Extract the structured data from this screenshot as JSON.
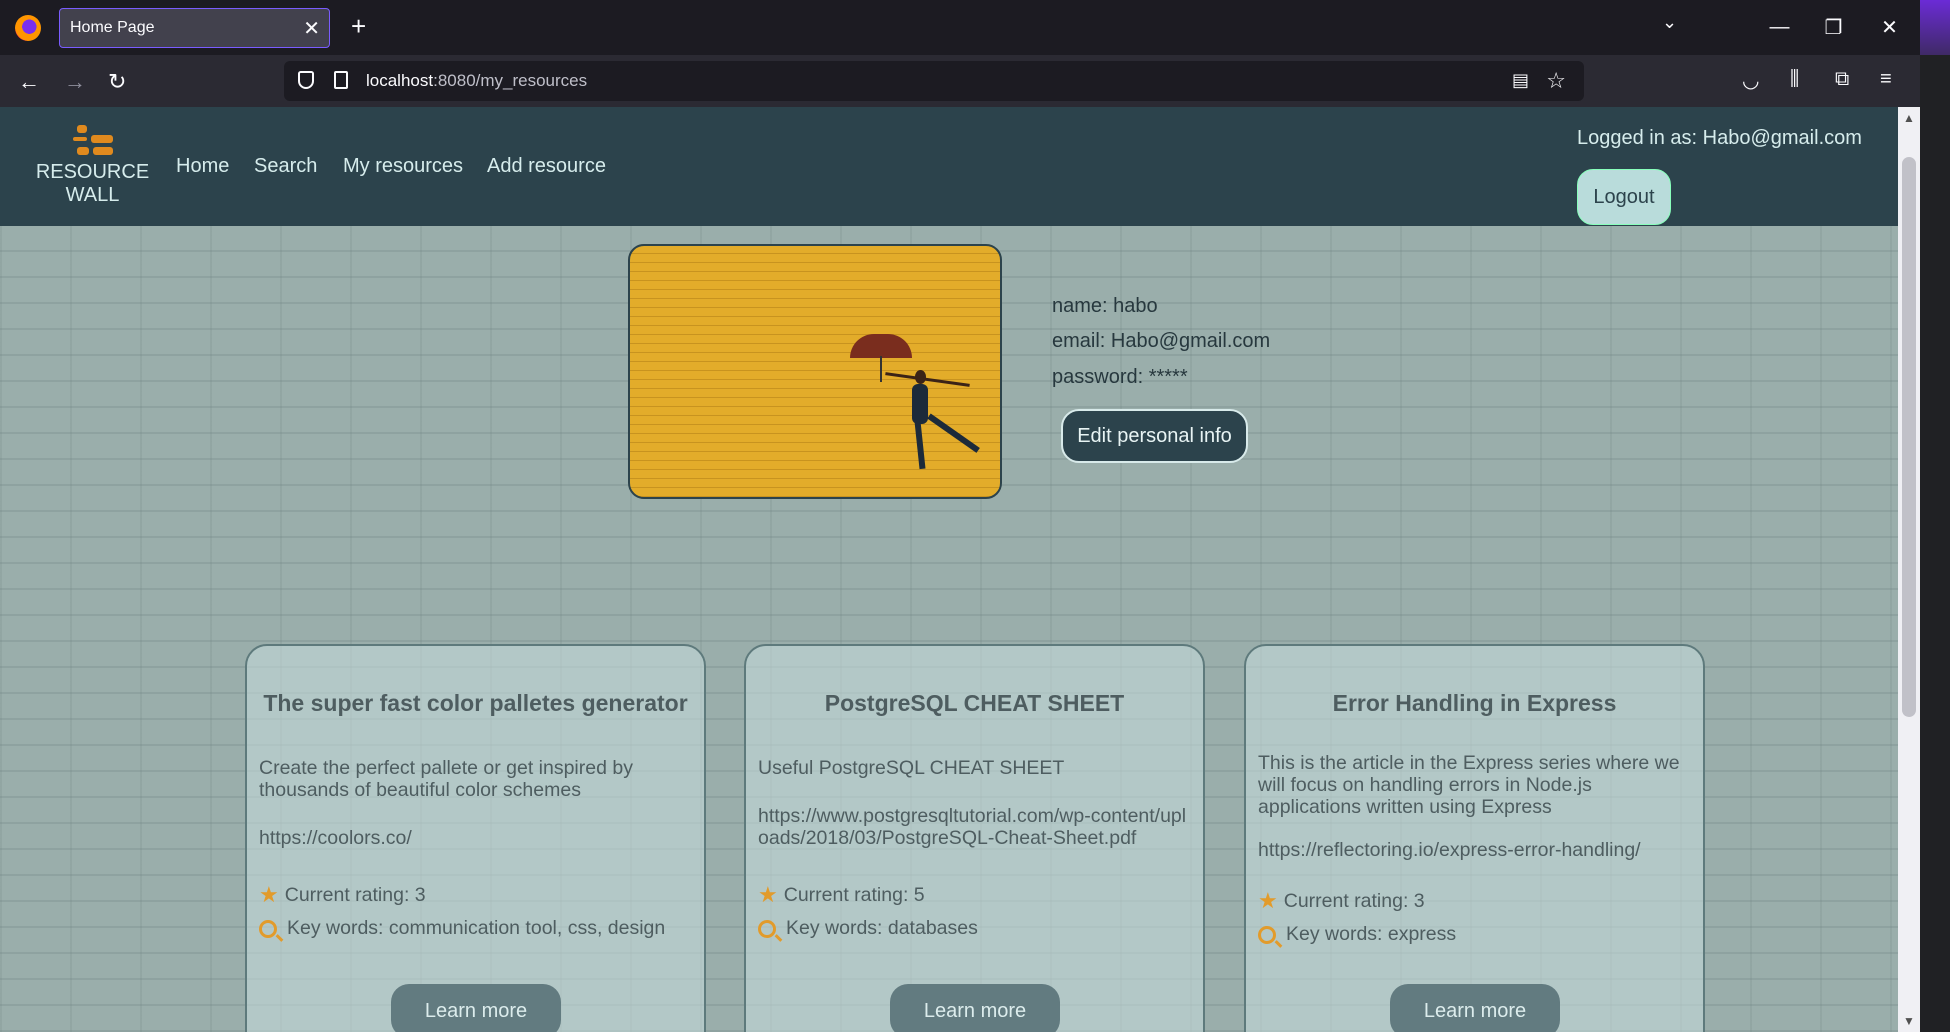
{
  "browser": {
    "tab_title": "Home Page",
    "url_host": "localhost",
    "url_path": ":8080/my_resources"
  },
  "header": {
    "logo_text_line1": "RESOURCE",
    "logo_text_line2": "WALL",
    "nav": [
      "Home",
      "Search",
      "My resources",
      "Add resource"
    ],
    "logged_in": "Logged in as: Habo@gmail.com",
    "logout_label": "Logout"
  },
  "profile": {
    "name": "name: habo",
    "email": "email: Habo@gmail.com",
    "password": "password: *****",
    "edit_label": "Edit personal info"
  },
  "resources": [
    {
      "title": "The super fast color palletes generator",
      "description": "Create the perfect pallete or get inspired by thousands of beautiful color schemes",
      "url": "https://coolors.co/",
      "rating": "Current rating: 3",
      "keywords": "Key words: communication tool, css, design",
      "button": "Learn more"
    },
    {
      "title": "PostgreSQL CHEAT SHEET",
      "description": "Useful PostgreSQL CHEAT SHEET",
      "url": "https://www.postgresqltutorial.com/wp-content/uploads/2018/03/PostgreSQL-Cheat-Sheet.pdf",
      "rating": "Current rating: 5",
      "keywords": "Key words: databases",
      "button": "Learn more"
    },
    {
      "title": "Error Handling in Express",
      "description": "This is the article in the Express series where we will focus on handling errors in Node.js applications written using Express",
      "url": "https://reflectoring.io/express-error-handling/",
      "rating": "Current rating: 3",
      "keywords": "Key words: express",
      "button": "Learn more"
    }
  ],
  "colors": {
    "header_bg": "#2c434c",
    "accent": "#e29b2b",
    "wall": "#9aaeab"
  }
}
